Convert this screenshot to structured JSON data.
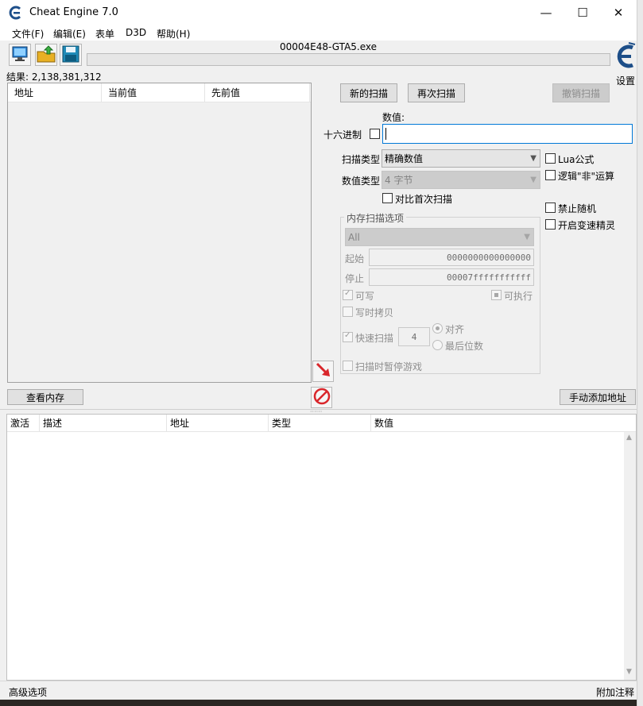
{
  "window": {
    "title": "Cheat Engine 7.0",
    "minimize": "—",
    "maximize": "☐",
    "close": "✕"
  },
  "menu": [
    "文件(F)",
    "编辑(E)",
    "表单",
    "D3D",
    "帮助(H)"
  ],
  "process_name": "00004E48-GTA5.exe",
  "settings_label": "设置",
  "results_label": "结果: 2,138,381,312",
  "found_list": {
    "columns": [
      "地址",
      "当前值",
      "先前值"
    ]
  },
  "buttons": {
    "new_scan": "新的扫描",
    "next_scan": "再次扫描",
    "undo_scan": "撤销扫描",
    "view_memory": "查看内存",
    "add_address": "手动添加地址"
  },
  "value": {
    "label": "数值:",
    "hex_label": "十六进制",
    "input": ""
  },
  "scan_type": {
    "label": "扫描类型",
    "selected": "精确数值"
  },
  "value_type": {
    "label": "数值类型",
    "selected": "4 字节"
  },
  "compare_first": "对比首次扫描",
  "options_right": {
    "lua": "Lua公式",
    "logic_not": "逻辑\"非\"运算",
    "no_random": "禁止随机",
    "speedhack": "开启变速精灵"
  },
  "memory_options": {
    "title": "内存扫描选项",
    "region": "All",
    "start_label": "起始",
    "start_value": "0000000000000000",
    "stop_label": "停止",
    "stop_value": "00007fffffffffff",
    "writable": "可写",
    "executable": "可执行",
    "copy_on_write": "写时拷贝",
    "fast_scan": "快速扫描",
    "fast_scan_value": "4",
    "align": "对齐",
    "last_digits": "最后位数",
    "pause_game": "扫描时暂停游戏"
  },
  "address_list": {
    "columns": [
      "激活",
      "描述",
      "地址",
      "类型",
      "数值"
    ]
  },
  "status": {
    "left": "高级选项",
    "right": "附加注释"
  },
  "colors": {
    "accent": "#0078d7",
    "arrow_red": "#d9262b"
  }
}
